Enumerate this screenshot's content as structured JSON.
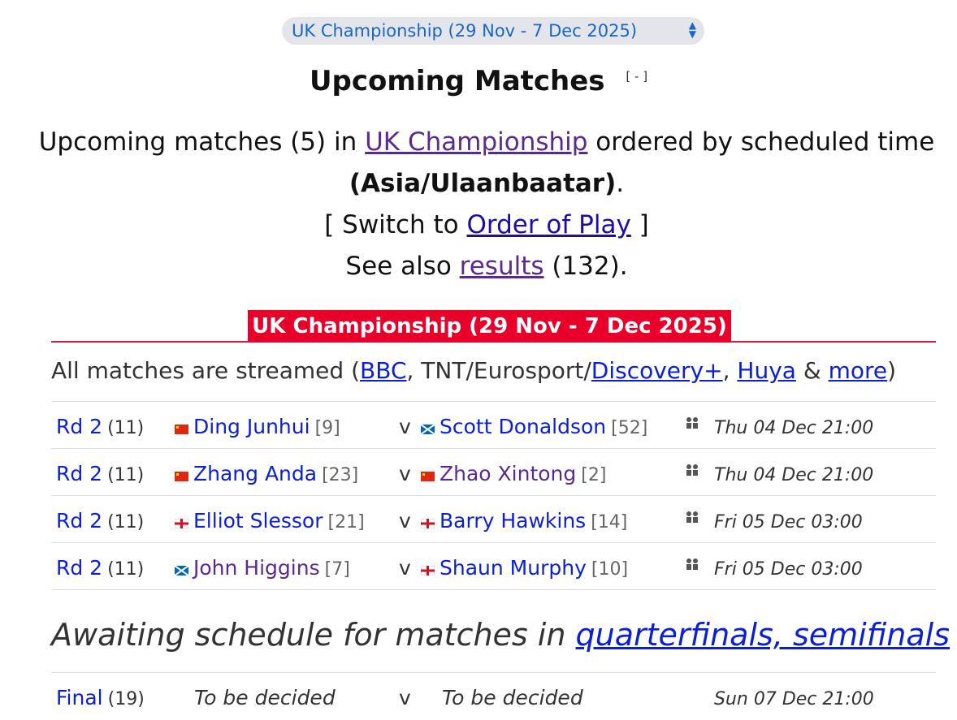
{
  "event_select": {
    "selected": "UK Championship (29 Nov - 7 Dec 2025)"
  },
  "heading": {
    "title": "Upcoming Matches",
    "toggle": "[ - ]"
  },
  "intro": {
    "t1": "Upcoming matches (5) in ",
    "link_event": "UK Championship",
    "t2": " ordered by scheduled time ",
    "timezone": "(Asia/Ulaanbaatar)",
    "t3": ".",
    "switch_pre": "[ Switch to ",
    "switch_link": "Order of Play",
    "switch_post": " ]",
    "see_pre": "See also ",
    "see_link": "results",
    "see_post": " (132)."
  },
  "banner": {
    "title": "UK Championship (29 Nov - 7 Dec 2025)"
  },
  "streamed": {
    "pre": "All matches are streamed (",
    "bbc": "BBC",
    "mid1": ", TNT/Eurosport/",
    "discovery": "Discovery+",
    "mid2": ", ",
    "huya": "Huya",
    "mid3": " & ",
    "more": "more",
    "post": ")"
  },
  "matches": [
    {
      "round": "Rd 2",
      "bestof": "(11)",
      "p1": "Ding Junhui",
      "p1_seed": "[9]",
      "p1_flag": "china",
      "vs": "v",
      "p2": "Scott Donaldson",
      "p2_seed": "[52]",
      "p2_flag": "scotland",
      "time": "Thu 04 Dec 21:00"
    },
    {
      "round": "Rd 2",
      "bestof": "(11)",
      "p1": "Zhang Anda",
      "p1_seed": "[23]",
      "p1_flag": "china",
      "vs": "v",
      "p2": "Zhao Xintong",
      "p2_seed": "[2]",
      "p2_flag": "china",
      "time": "Thu 04 Dec 21:00"
    },
    {
      "round": "Rd 2",
      "bestof": "(11)",
      "p1": "Elliot Slessor",
      "p1_seed": "[21]",
      "p1_flag": "england",
      "vs": "v",
      "p2": "Barry Hawkins",
      "p2_seed": "[14]",
      "p2_flag": "england",
      "time": "Fri 05 Dec 03:00"
    },
    {
      "round": "Rd 2",
      "bestof": "(11)",
      "p1": "John Higgins",
      "p1_seed": "[7]",
      "p1_flag": "scotland",
      "vs": "v",
      "p2": "Shaun Murphy",
      "p2_seed": "[10]",
      "p2_flag": "england",
      "time": "Fri 05 Dec 03:00"
    }
  ],
  "awaiting": {
    "pre": "Awaiting schedule for matches in ",
    "link": "quarterfinals, semifinals"
  },
  "final": {
    "round": "Final",
    "bestof": "(19)",
    "p1": "To be decided",
    "vs": "v",
    "p2": "To be decided",
    "time": "Sun 07 Dec 21:00"
  },
  "colors": {
    "banner": "#e8002a",
    "link": "#0b1fd6",
    "visited": "#5b2a91"
  }
}
